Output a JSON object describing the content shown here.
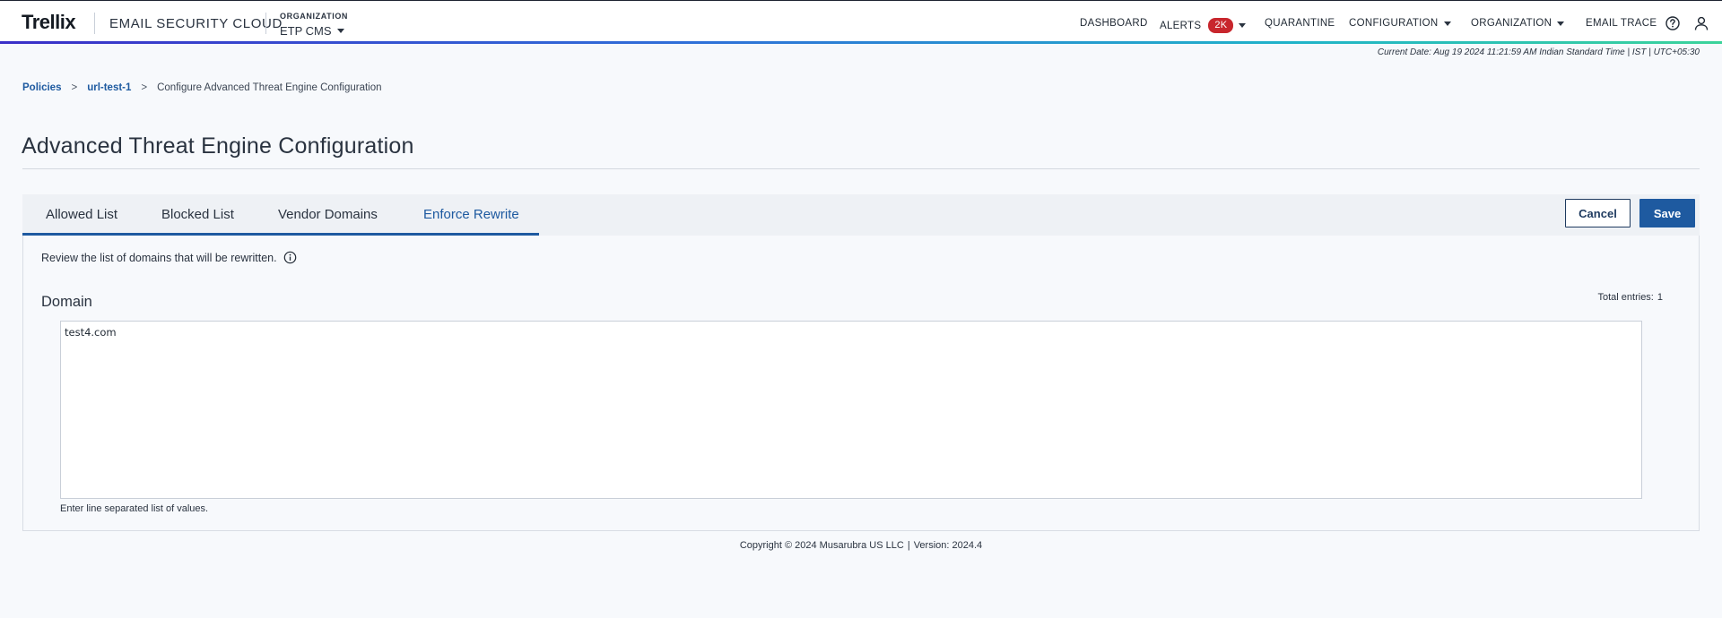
{
  "header": {
    "logo": "Trellix",
    "product_name": "EMAIL SECURITY CLOUD",
    "org_label": "ORGANIZATION",
    "org_value": "ETP CMS",
    "nav": {
      "dashboard": "DASHBOARD",
      "alerts": "ALERTS",
      "alerts_badge": "2K",
      "quarantine": "QUARANTINE",
      "configuration": "CONFIGURATION",
      "organization": "ORGANIZATION",
      "email_trace": "EMAIL TRACE"
    },
    "icons": [
      "help-icon",
      "user-icon"
    ],
    "accent_color": "#1e5aa0",
    "badge_color": "#c8262d"
  },
  "current_date": "Current Date: Aug 19 2024 11:21:59 AM Indian Standard Time | IST | UTC+05:30",
  "breadcrumb": {
    "items": [
      "Policies",
      "url-test-1"
    ],
    "separator": ">",
    "current": "Configure Advanced Threat Engine Configuration"
  },
  "page_title": "Advanced Threat Engine Configuration",
  "tabs": [
    {
      "label": "Allowed List",
      "active": false
    },
    {
      "label": "Blocked List",
      "active": false
    },
    {
      "label": "Vendor Domains",
      "active": false
    },
    {
      "label": "Enforce Rewrite",
      "active": true
    }
  ],
  "actions": {
    "cancel": "Cancel",
    "save": "Save"
  },
  "panel": {
    "description": "Review the list of domains that will be rewritten.",
    "domain_label": "Domain",
    "total_entries_label": "Total entries:",
    "total_entries_value": "1",
    "domains_value": "test4.com",
    "helper_text": "Enter line separated list of values."
  },
  "footer": {
    "copyright": "Copyright © 2024 Musarubra US LLC",
    "separator": "|",
    "version": "Version: 2024.4"
  }
}
